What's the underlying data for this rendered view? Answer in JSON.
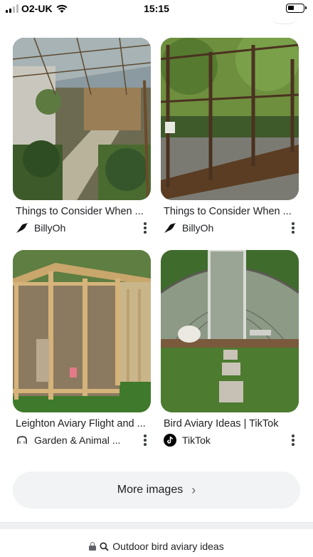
{
  "status_bar": {
    "carrier": "O2-UK",
    "time": "15:15"
  },
  "results": [
    {
      "title": "Things to Consider When ...",
      "source": "BillyOh",
      "source_icon": "billyoh-bird-logo-icon"
    },
    {
      "title": "Things to Consider When ...",
      "source": "BillyOh",
      "source_icon": "billyoh-bird-logo-icon"
    },
    {
      "title": "Leighton Aviary Flight and ...",
      "source": "Garden & Animal ...",
      "source_icon": "garden-animal-logo-icon"
    },
    {
      "title": "Bird Aviary Ideas | TikTok",
      "source": "TikTok",
      "source_icon": "tiktok-logo-icon"
    }
  ],
  "more_button": {
    "label": "More images",
    "icon": "chevron-right-icon"
  },
  "address_bar": {
    "query": "Outdoor bird aviary ideas",
    "icons": [
      "lock-icon",
      "search-icon"
    ]
  }
}
